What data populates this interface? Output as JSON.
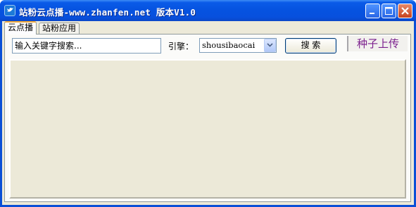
{
  "window": {
    "title": "站粉云点播-www.zhanfen.net 版本V1.0",
    "app_icon": "app-icon",
    "controls": {
      "minimize_icon": "minimize-icon",
      "maximize_icon": "maximize-icon",
      "close_icon": "close-icon"
    }
  },
  "tabs": [
    {
      "label": "云点播",
      "active": true
    },
    {
      "label": "站粉应用",
      "active": false
    }
  ],
  "search": {
    "value": "输入关键字搜索..."
  },
  "engine": {
    "label": "引擎：",
    "selected": "shousibaocai"
  },
  "buttons": {
    "search_label": "搜 索"
  },
  "links": {
    "upload_label": "种子上传"
  },
  "colors": {
    "title_bar": "#0653e0",
    "panel": "#ece9d8",
    "link": "#7b1f8d",
    "close": "#c6421e"
  }
}
